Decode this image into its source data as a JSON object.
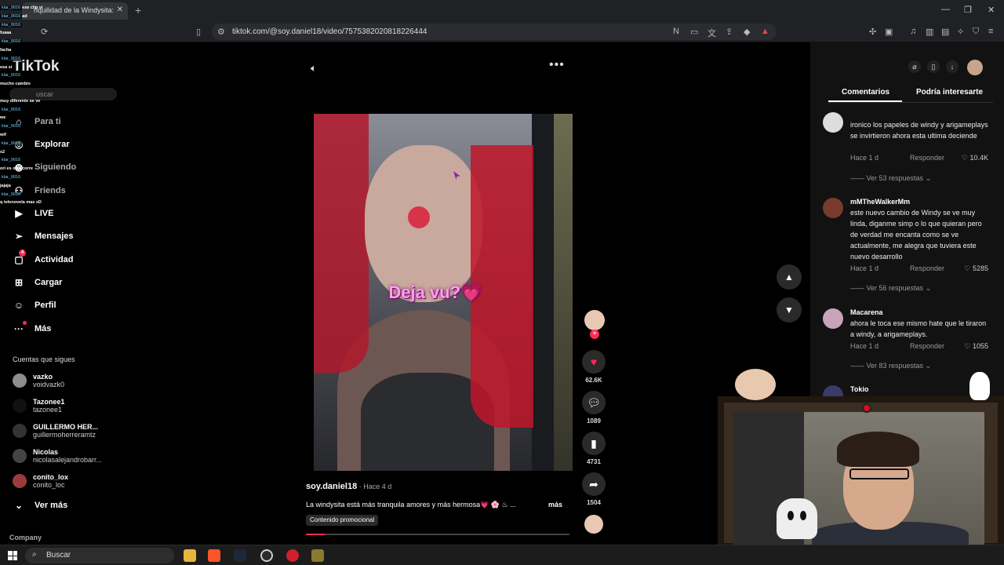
{
  "browser": {
    "tab_title": "nquilidad de la Windysita:",
    "url": "tiktok.com/@soy.daniel18/video/7575382020818226444"
  },
  "chat": [
    {
      "name": "klar_9016",
      "msg": "ese clip vi"
    },
    {
      "name": "klar_9016",
      "msg": "ad"
    },
    {
      "name": "klar_9016",
      "msg": ""
    },
    {
      "name": "",
      "msg": "fuaaa"
    },
    {
      "name": "klar_9016",
      "msg": ""
    },
    {
      "name": "",
      "msg": "facha"
    },
    {
      "name": "klar_9016",
      "msg": ""
    },
    {
      "name": "",
      "msg": "esa sí"
    },
    {
      "name": "klar_9016",
      "msg": ""
    },
    {
      "name": "",
      "msg": "mucho cambio"
    },
    {
      "name": "",
      "msg": ""
    },
    {
      "name": "",
      "msg": "muy diferente se ve"
    },
    {
      "name": "klar_9016",
      "msg": ""
    },
    {
      "name": "",
      "msg": "we"
    },
    {
      "name": "klar_9016",
      "msg": ""
    },
    {
      "name": "",
      "msg": "wtf"
    },
    {
      "name": "klar_9016",
      "msg": ""
    },
    {
      "name": "",
      "msg": "x2"
    },
    {
      "name": "klar_9016",
      "msg": ""
    },
    {
      "name": "",
      "msg": "ori es otra corre"
    },
    {
      "name": "klar_9016",
      "msg": ""
    },
    {
      "name": "",
      "msg": "jajaja"
    },
    {
      "name": "klar_9016",
      "msg": ""
    },
    {
      "name": "",
      "msg": "q telenovela mas xD"
    }
  ],
  "nav": {
    "logo": "TikTok",
    "search_placeholder": "uscar",
    "items": [
      {
        "label": "Para ti"
      },
      {
        "label": "Explorar"
      },
      {
        "label": "Siguiendo"
      },
      {
        "label": "Friends"
      },
      {
        "label": "LIVE"
      },
      {
        "label": "Mensajes"
      },
      {
        "label": "Actividad",
        "badge": "4"
      },
      {
        "label": "Cargar"
      },
      {
        "label": "Perfil"
      },
      {
        "label": "Más"
      }
    ],
    "following_title": "Cuentas que sigues",
    "following": [
      {
        "name": "vazko",
        "handle": "voidvazk0"
      },
      {
        "name": "Tazonee1",
        "handle": "tazonee1"
      },
      {
        "name": "GUILLERMO HER...",
        "handle": "guillermoherreramtz"
      },
      {
        "name": "Nicolas",
        "handle": "nicolasalejandrobarr..."
      },
      {
        "name": "conito_lox",
        "handle": "conito_loc"
      }
    ],
    "see_more": "Ver más",
    "company": "Company"
  },
  "video": {
    "caption": "Deja vu?💗",
    "author": "soy.daniel18",
    "ago": " · Hace 4 d",
    "description": "La windysita está más tranquila amores y más hermosa💗 🌸 ♨ ...",
    "more": "más",
    "promo": "Contenido promocional",
    "progress": 0.07
  },
  "actions": {
    "likes": "62.6K",
    "comments": "1089",
    "saves": "4731",
    "shares": "1504"
  },
  "panel": {
    "tab_comments": "Comentarios",
    "tab_interest": "Podría interesarte"
  },
  "comments": [
    {
      "user": "",
      "text": "ironico los papeles de windy y arigameplays se invirtieron ahora esta ultima deciende",
      "time": "Hace 1 d",
      "reply": "Responder",
      "likes": "10.4K",
      "replies": "Ver 53 respuestas"
    },
    {
      "user": "mMTheWalkerMm",
      "text": "este nuevo cambio de Windy se ve muy linda, diganme simp o lo que quieran pero de verdad me encanta como se ve actualmente, me alegra que tuviera este nuevo desarrollo",
      "time": "Hace 1 d",
      "reply": "Responder",
      "likes": "5285",
      "replies": "Ver 56 respuestas"
    },
    {
      "user": "Macarena",
      "text": "ahora le toca ese mismo hate que le tiraron a windy, a arigameplays.",
      "time": "Hace 1 d",
      "reply": "Responder",
      "likes": "1055",
      "replies": "Ver 83 respuestas"
    },
    {
      "user": "Tokio",
      "text": "",
      "time": "",
      "reply": "",
      "likes": "",
      "replies": ""
    }
  ],
  "taskbar": {
    "search": "Buscar"
  },
  "colors": {
    "accent": "#fe2c55",
    "caption": "#ff9ef0"
  }
}
